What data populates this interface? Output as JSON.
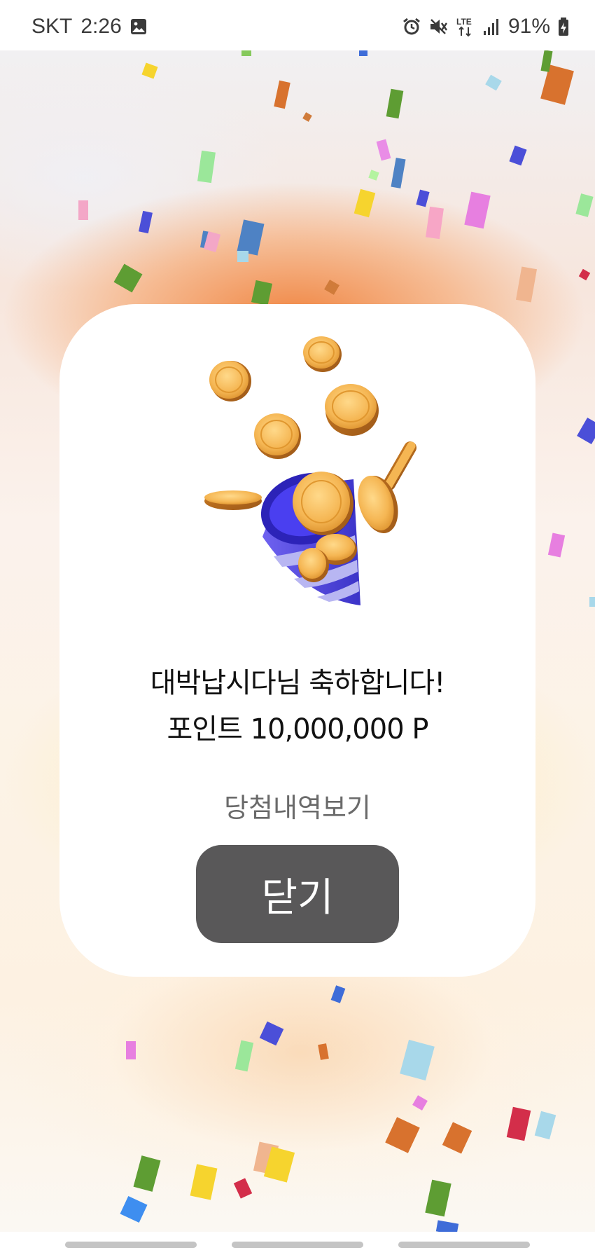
{
  "status_bar": {
    "carrier": "SKT",
    "time": "2:26",
    "gallery_icon": "image-notification-icon",
    "alarm_icon": "alarm-icon",
    "mute_icon": "vibrate-mute-icon",
    "network": "LTE",
    "signal_icon": "signal-bars-icon",
    "battery_percent": "91%",
    "battery_icon": "battery-charging-icon"
  },
  "dialog": {
    "illustration": "coins-party-popper-illustration",
    "title": "대박납시다님 축하합니다!",
    "points_text": "포인트 10,000,000 P",
    "history_link": "당첨내역보기",
    "close_label": "닫기"
  },
  "colors": {
    "button_bg": "#595859",
    "button_text": "#ffffff",
    "link_text": "#6a6a6a",
    "accent_orange": "#f08a48",
    "coin_gold": "#f2b24c",
    "popper_purple": "#5a4de0"
  },
  "nav_bar": {
    "items": [
      "recent-apps-handle",
      "home-handle",
      "back-handle"
    ]
  }
}
